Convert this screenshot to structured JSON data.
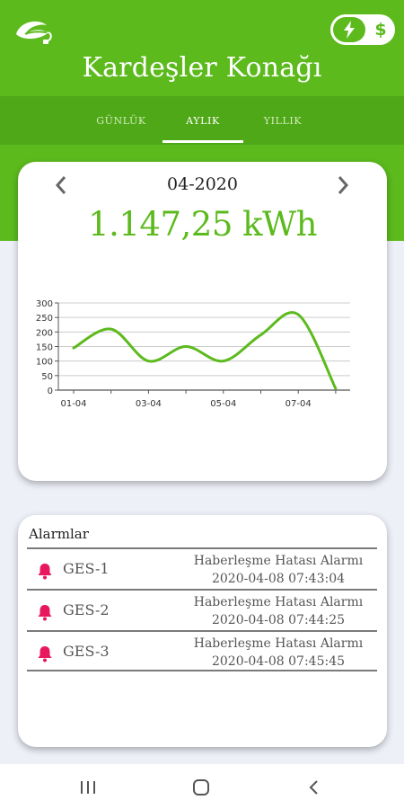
{
  "header": {
    "title": "Kardeşler Konağı",
    "logo_icon": "leaf-plug-icon",
    "toggle": {
      "left_icon": "lightning-icon",
      "right_label": "$"
    }
  },
  "tabs": [
    {
      "label": "GÜNLÜK",
      "active": false
    },
    {
      "label": "AYLIK",
      "active": true
    },
    {
      "label": "YILLIK",
      "active": false
    }
  ],
  "summary": {
    "period": "04-2020",
    "energy": "1.147,25 kWh",
    "prev_icon": "chevron-left-icon",
    "next_icon": "chevron-right-icon"
  },
  "chart_data": {
    "type": "line",
    "x": [
      "01-04",
      "02-04",
      "03-04",
      "04-04",
      "05-04",
      "06-04",
      "07-04",
      "08-04"
    ],
    "xtick_labels": [
      "01-04",
      "03-04",
      "05-04",
      "07-04"
    ],
    "series": [
      {
        "values": [
          145,
          210,
          100,
          150,
          100,
          190,
          260,
          5
        ],
        "color": "#5cba1d"
      }
    ],
    "yticks": [
      0,
      50,
      100,
      150,
      200,
      250,
      300
    ],
    "ylim": [
      0,
      300
    ],
    "grid": true
  },
  "alarms": {
    "title": "Alarmlar",
    "items": [
      {
        "name": "GES-1",
        "message": "Haberleşme Hatası Alarmı",
        "time": "2020-04-08 07:43:04"
      },
      {
        "name": "GES-2",
        "message": "Haberleşme Hatası Alarmı",
        "time": "2020-04-08 07:44:25"
      },
      {
        "name": "GES-3",
        "message": "Haberleşme Hatası Alarmı",
        "time": "2020-04-08 07:45:45"
      }
    ],
    "bell_color": "#e8185f"
  },
  "system_nav": {
    "recents_icon": "recents-icon",
    "home_icon": "home-icon",
    "back_icon": "back-icon"
  },
  "colors": {
    "brand": "#5cba1d",
    "brand_dark": "#4fa817",
    "alarm": "#e8185f"
  }
}
